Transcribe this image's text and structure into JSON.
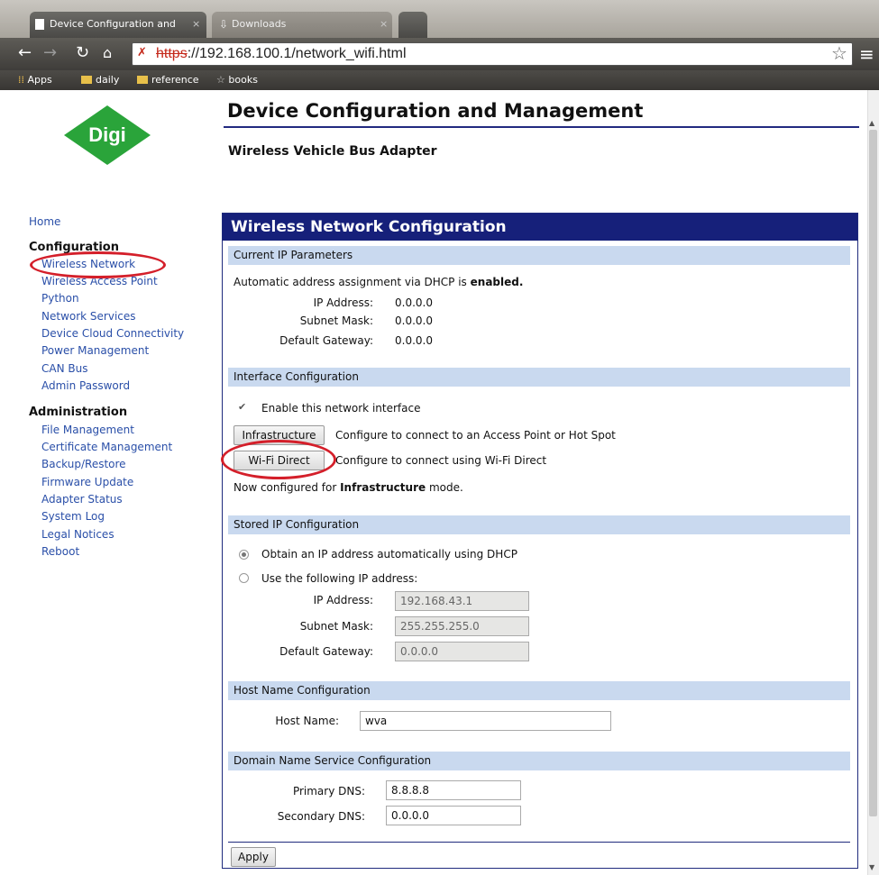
{
  "browser": {
    "tabs": [
      {
        "label": "Device Configuration and"
      },
      {
        "label": "Downloads"
      },
      {
        "label": ""
      }
    ],
    "url": {
      "protocol": "https",
      "rest": "://192.168.100.1/network_wifi.html"
    },
    "bookmarks": {
      "apps": "Apps",
      "items": [
        "daily",
        "reference",
        "books"
      ]
    }
  },
  "header": {
    "logo_text": "Digi",
    "title": "Device Configuration and Management",
    "subtitle": "Wireless Vehicle Bus Adapter"
  },
  "sidebar": {
    "home": "Home",
    "configuration_heading": "Configuration",
    "configuration_items": [
      "Wireless Network",
      "Wireless Access Point",
      "Python",
      "Network Services",
      "Device Cloud Connectivity",
      "Power Management",
      "CAN Bus",
      "Admin Password"
    ],
    "administration_heading": "Administration",
    "administration_items": [
      "File Management",
      "Certificate Management",
      "Backup/Restore",
      "Firmware Update",
      "Adapter Status",
      "System Log",
      "Legal Notices",
      "Reboot"
    ]
  },
  "panel": {
    "title": "Wireless Network Configuration",
    "current_ip": {
      "heading": "Current IP Parameters",
      "dhcp_text": "Automatic address assignment via DHCP is",
      "dhcp_state": "enabled.",
      "ip_label": "IP Address:",
      "ip_value": "0.0.0.0",
      "mask_label": "Subnet Mask:",
      "mask_value": "0.0.0.0",
      "gw_label": "Default Gateway:",
      "gw_value": "0.0.0.0"
    },
    "interface": {
      "heading": "Interface Configuration",
      "enable_label": "Enable this network interface",
      "enable_checked": true,
      "infra_button": "Infrastructure",
      "infra_desc": "Configure to connect to an Access Point or Hot Spot",
      "wifidirect_button": "Wi-Fi Direct",
      "wifidirect_desc": "Configure to connect using Wi-Fi Direct",
      "mode_prefix": "Now configured for",
      "mode_value": "Infrastructure",
      "mode_suffix": "mode."
    },
    "stored_ip": {
      "heading": "Stored IP Configuration",
      "radio_dhcp": "Obtain an IP address automatically using DHCP",
      "radio_static": "Use the following IP address:",
      "selected": "dhcp",
      "ip_label": "IP Address:",
      "ip_value": "192.168.43.1",
      "mask_label": "Subnet Mask:",
      "mask_value": "255.255.255.0",
      "gw_label": "Default Gateway:",
      "gw_value": "0.0.0.0"
    },
    "host": {
      "heading": "Host Name Configuration",
      "label": "Host Name:",
      "value": "wva"
    },
    "dns": {
      "heading": "Domain Name Service Configuration",
      "primary_label": "Primary DNS:",
      "primary_value": "8.8.8.8",
      "secondary_label": "Secondary DNS:",
      "secondary_value": "0.0.0.0"
    },
    "apply_button": "Apply"
  },
  "colors": {
    "panel_header": "#16207a",
    "section_header": "#c9d9ef",
    "sidebar_link": "#2a4fa8",
    "annotation_red": "#d41f2a",
    "logo_green": "#2aa43a"
  },
  "annotations": [
    "red-oval-wireless-network",
    "red-oval-wifi-direct"
  ]
}
